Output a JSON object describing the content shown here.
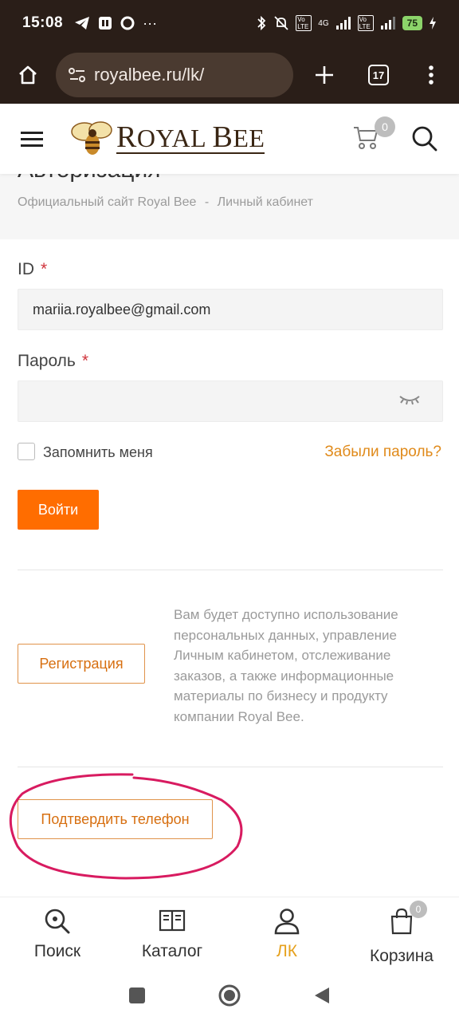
{
  "status_bar": {
    "time": "15:08",
    "battery": "75",
    "network": "4G",
    "volte": "Vo LTE"
  },
  "browser": {
    "url": "royalbee.ru/lk/",
    "tab_count": "17"
  },
  "header": {
    "logo_text_R": "R",
    "logo_text_oyal": "OYAL ",
    "logo_text_B": "B",
    "logo_text_ee": "EE",
    "cart_count": "0"
  },
  "breadcrumb": {
    "page_title": "Авторизация",
    "items": [
      "Официальный сайт Royal Bee",
      "Личный кабинет"
    ],
    "separator": "-"
  },
  "form": {
    "id_label": "ID",
    "id_value": "mariia.royalbee@gmail.com",
    "password_label": "Пароль",
    "password_value": "",
    "required_mark": "*",
    "remember_label": "Запомнить меня",
    "forgot_link": "Забыли пароль?",
    "login_button": "Войти"
  },
  "register": {
    "button": "Регистрация",
    "info": "Вам будет доступно использование персональных данных, управление Личным кабинетом, отслеживание заказов, а также информационные материалы по бизнесу и продукту компании Royal Bee."
  },
  "confirm_phone_button": "Подтвердить телефон",
  "bottom_nav": {
    "items": [
      {
        "label": "Поиск",
        "icon": "search-icon"
      },
      {
        "label": "Каталог",
        "icon": "book-icon"
      },
      {
        "label": "ЛК",
        "icon": "user-icon"
      },
      {
        "label": "Корзина",
        "icon": "shopping-bag-icon"
      }
    ],
    "cart_count": "0"
  },
  "colors": {
    "accent": "#ff6d00",
    "link": "#e08a1a",
    "active_nav": "#e6a11d",
    "annotation": "#d81b60"
  }
}
